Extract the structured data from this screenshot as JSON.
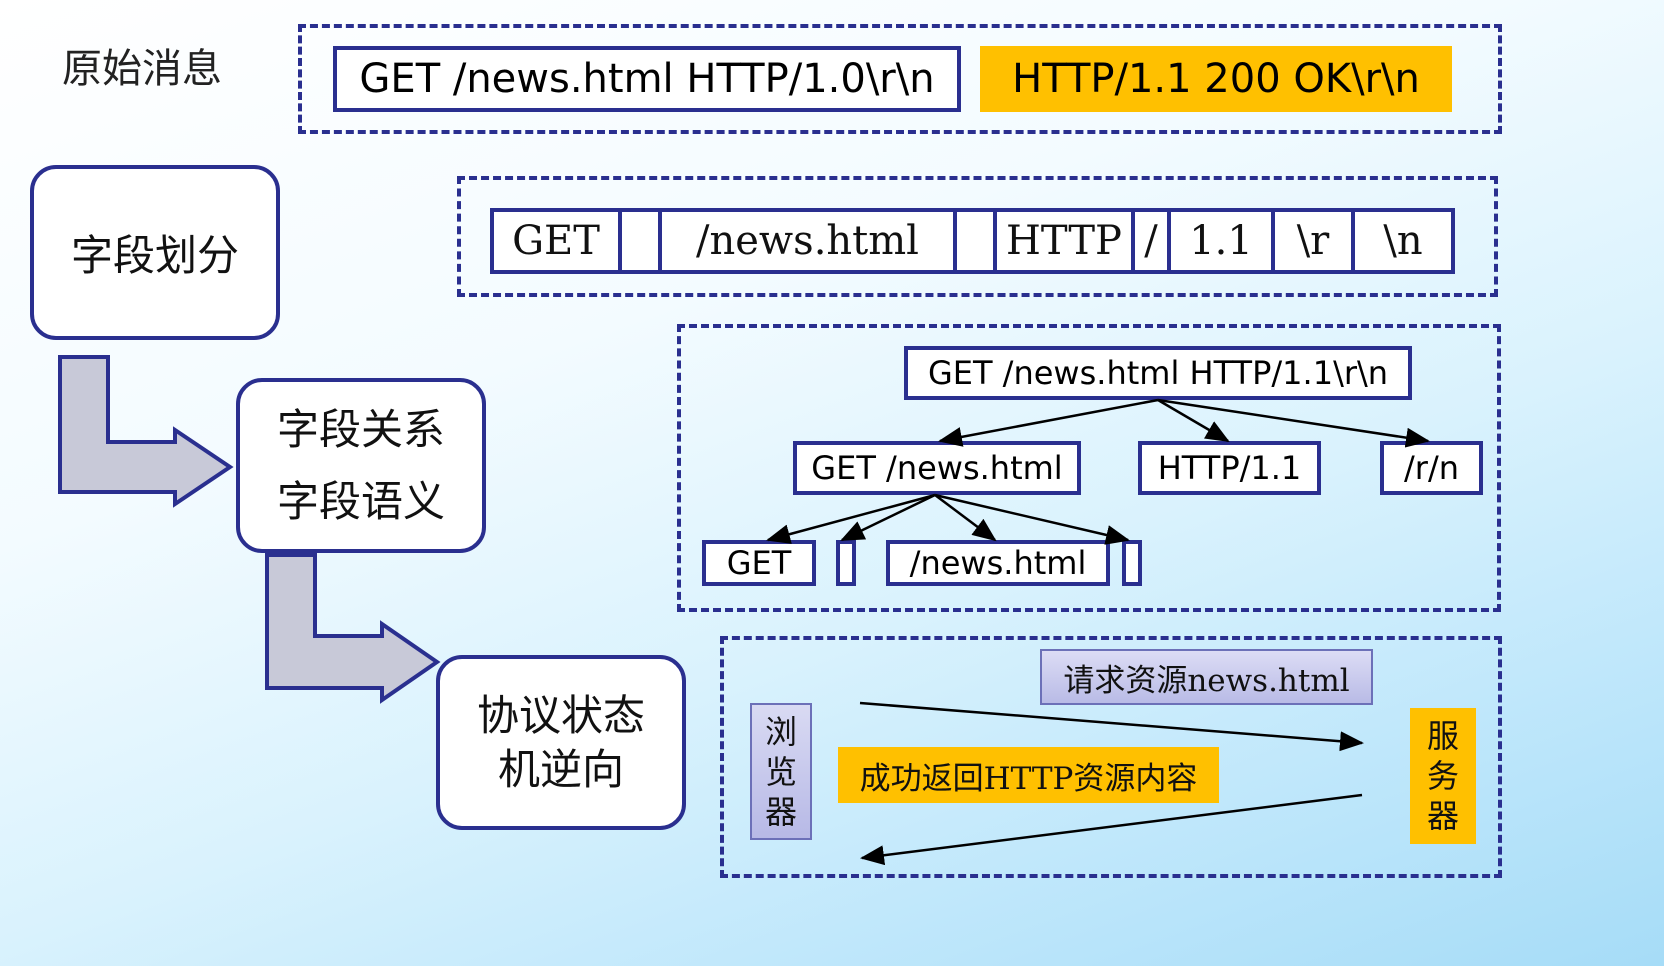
{
  "colors": {
    "frame": "#2a2f8f",
    "highlight": "#ffc000",
    "lavender": "#c7c9ec"
  },
  "raw_label": "原始消息",
  "raw": {
    "request": "GET /news.html HTTP/1.0\\r\\n",
    "response": "HTTP/1.1 200 OK\\r\\n"
  },
  "steps": {
    "step1": "字段划分",
    "step2_line1": "字段关系",
    "step2_line2": "字段语义",
    "step3_line1": "协议状态",
    "step3_line2": "机逆向"
  },
  "fields": [
    "GET",
    "",
    "/news.html",
    "",
    "HTTP",
    "/",
    "1.1",
    "\\r",
    "\\n"
  ],
  "tree": {
    "root": "GET /news.html HTTP/1.1\\r\\n",
    "level1": [
      "GET /news.html",
      "HTTP/1.1",
      "/r/n"
    ],
    "level2": [
      "GET",
      "",
      "/news.html",
      ""
    ]
  },
  "state": {
    "client_label": [
      "浏",
      "览",
      "器"
    ],
    "server_label": [
      "服",
      "务",
      "器"
    ],
    "request_label": "请求资源news.html",
    "response_label": "成功返回HTTP资源内容"
  },
  "icons": [
    "down-right-arrow-icon",
    "down-right-arrow-icon"
  ]
}
